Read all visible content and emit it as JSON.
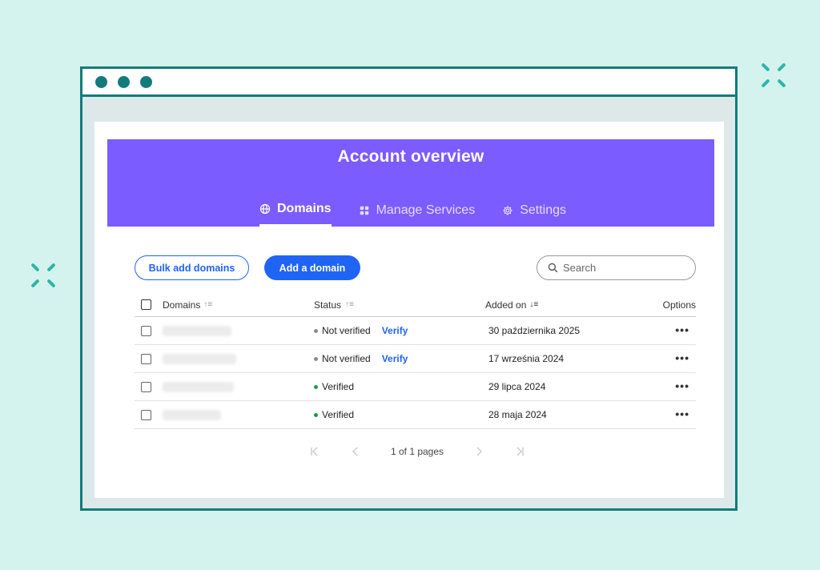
{
  "window": {
    "title": "Account overview"
  },
  "tabs": [
    {
      "label": "Domains",
      "icon": "globe-icon",
      "active": true
    },
    {
      "label": "Manage Services",
      "icon": "grid-icon",
      "active": false
    },
    {
      "label": "Settings",
      "icon": "gear-icon",
      "active": false
    }
  ],
  "toolbar": {
    "bulk_label": "Bulk add domains",
    "add_label": "Add a domain",
    "search_placeholder": "Search"
  },
  "table": {
    "headers": {
      "domains": "Domains",
      "status": "Status",
      "added_on": "Added on",
      "options": "Options"
    },
    "rows": [
      {
        "status": "Not verified",
        "status_color": "#8a8a8a",
        "verify": "Verify",
        "added": "30 października 2025",
        "options": "•••"
      },
      {
        "status": "Not verified",
        "status_color": "#8a8a8a",
        "verify": "Verify",
        "added": "17 września 2024",
        "options": "•••"
      },
      {
        "status": "Verified",
        "status_color": "#1e9a4a",
        "verify": "",
        "added": "29 lipca 2024",
        "options": "•••"
      },
      {
        "status": "Verified",
        "status_color": "#1e9a4a",
        "verify": "",
        "added": "28 maja 2024",
        "options": "•••"
      }
    ]
  },
  "pagination": {
    "label": "1 of 1 pages"
  },
  "colors": {
    "accent": "#7b5cff",
    "primary": "#1f64f5",
    "frame": "#137b7b",
    "background": "#d5f3ee"
  }
}
